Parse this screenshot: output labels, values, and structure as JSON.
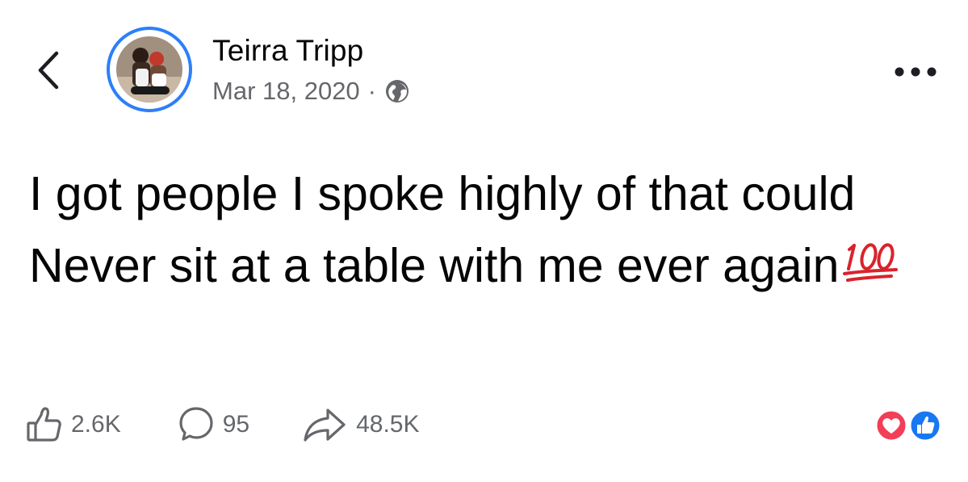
{
  "header": {
    "back_icon": "chevron-left-icon",
    "author_name": "Teirra Tripp",
    "date": "Mar 18, 2020",
    "separator": "·",
    "audience_icon": "globe-icon",
    "more_icon": "more-horizontal-icon"
  },
  "post": {
    "text": "I got people I spoke highly of that could Never sit at a table with me ever again",
    "emoji": "💯",
    "emoji_icon": "hundred-points-icon"
  },
  "actions": {
    "like_count": "2.6K",
    "comment_count": "95",
    "share_count": "48.5K"
  },
  "reactions": {
    "types": [
      "love",
      "like"
    ],
    "colors": {
      "love": "#f33e58",
      "like": "#1877f2"
    }
  },
  "colors": {
    "accent": "#2d7ff9",
    "text_primary": "#050505",
    "text_secondary": "#65676b"
  }
}
